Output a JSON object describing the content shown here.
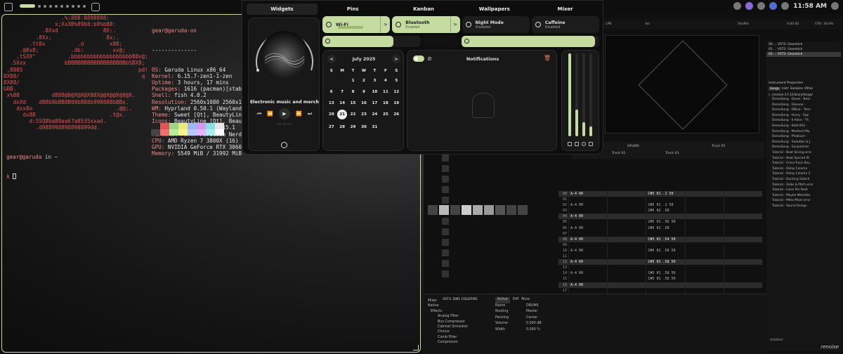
{
  "topbar": {
    "time": "11:58 AM"
  },
  "terminal": {
    "ascii": [
      "                  .%;888:8898898:",
      "                x;XxXB%89b8:b8%b88:",
      "            .8Xxd              8X:.",
      "          .8Xx;                 8x:.",
      "        .tt8x          .d        x88;",
      "     .@8x8;          .db:         xx@;",
      "    ,tSXX°          .bbbbbbbbbbbbbbbbbbbB8x@;",
      "  .SXxx            bBBBBBBBBBBBBBBBBBBbSBX8;",
      " ,888S                                    pd!",
      "8X88/                                      q",
      "8X88/",
      "GBB.",
      " x%88          d888@8@X@X@X88X@@X@@X@8@X.",
      "   dxXd    dB8b8bBB8B08bB88b998888bBBx.",
      "    dxx8o                          .@@;.",
      "      dx88                       .t@x.",
      "        d:SSQ8ba89aa67a8535xxad.",
      "          .d988998898898899dd."
    ],
    "info_header": "gear@garuda-os",
    "info_sep": "--------------",
    "info": [
      {
        "k": "OS",
        "v": "Garuda Linux x86_64"
      },
      {
        "k": "Kernel",
        "v": "6.15.7-zen1-1-zen"
      },
      {
        "k": "Uptime",
        "v": "3 hours, 17 mins"
      },
      {
        "k": "Packages",
        "v": "1616 (pacman)[stable]"
      },
      {
        "k": "Shell",
        "v": "fish 4.0.2"
      },
      {
        "k": "Resolution",
        "v": "2560x1080 2560x1080"
      },
      {
        "k": "WM",
        "v": "Hyprland 0.50.1 (Wayland)"
      },
      {
        "k": "Theme",
        "v": "Sweet [Qt], BeautyLine ["
      },
      {
        "k": "Icons",
        "v": "BeautyLine [Qt], BeautyL"
      },
      {
        "k": "Terminal",
        "v": "alacritty 0.15.1"
      },
      {
        "k": "Terminal Font",
        "v": "FiraCode Nerd Fo"
      },
      {
        "k": "CPU",
        "v": "AMD Ryzen 7 3800X (16) @ 4"
      },
      {
        "k": "GPU",
        "v": "NVIDIA GeForce RTX 3060 Li"
      },
      {
        "k": "Memory",
        "v": "5549 MiB / 31992 MiB"
      }
    ],
    "palette_top": [
      "#222222",
      "#e25555",
      "#9bd68a",
      "#eaea7a",
      "#9db8f0",
      "#d49af0",
      "#8ae0e0",
      "#e6e6e6"
    ],
    "palette_bottom": [
      "#444444",
      "#f07070",
      "#b6ec9c",
      "#f5f590",
      "#b4c8ff",
      "#e2b4ff",
      "#a8f0f0",
      "#ffffff"
    ],
    "prompt_user": "gear@garuda",
    "prompt_in": "in ~",
    "prompt_arrow": "λ"
  },
  "panel": {
    "tabs": [
      "Widgets",
      "Pins",
      "Kanban",
      "Wallpapers",
      "Mixer"
    ],
    "active_tab": 0,
    "player": {
      "title": "Electronic music and merch ...",
      "time": "--:-- / --:--",
      "prev": "⏮",
      "rewind": "⏪",
      "play": "▶",
      "forward": "⏩",
      "next": "⏭"
    },
    "toggles": [
      {
        "label": "Wi-Fi",
        "sub": "",
        "on": true,
        "chevron": ">"
      },
      {
        "label": "Bluetooth",
        "sub": "Enabled",
        "on": true,
        "chevron": ">"
      },
      {
        "label": "Night Mode",
        "sub": "Disabled",
        "on": false,
        "chevron": ""
      },
      {
        "label": "Caffeine",
        "sub": "Disabled",
        "on": false,
        "chevron": ""
      }
    ],
    "volume_level": 0.72,
    "mic_level": 0.97,
    "calendar": {
      "month": "July 2025",
      "prev": "<",
      "next": ">",
      "dow": [
        "S",
        "M",
        "T",
        "W",
        "T",
        "F",
        "S"
      ],
      "days": [
        "",
        "",
        "1",
        "2",
        "3",
        "4",
        "5",
        "6",
        "7",
        "8",
        "9",
        "10",
        "11",
        "12",
        "13",
        "14",
        "15",
        "16",
        "17",
        "18",
        "19",
        "20",
        "21",
        "22",
        "23",
        "24",
        "25",
        "26",
        "27",
        "28",
        "29",
        "30",
        "31",
        "",
        ""
      ],
      "today": "21"
    },
    "notifications": {
      "title": "Notifications"
    },
    "mixer_levels": [
      1.0,
      0.32,
      0.17,
      0.12
    ],
    "colors": {
      "accent": "#c5dca0",
      "trash": "#e07a50"
    }
  },
  "renoise": {
    "top_labels": [
      "LPB",
      "Vol",
      "Shuffle",
      "0.00.00",
      "CPU: 16.6%"
    ],
    "instruments": [
      "00 ... VST3: Geonkick",
      "01 ... VST3: Geonkick",
      "02 ... VST3: Geonkick"
    ],
    "instrument_properties": "Instrument Properties",
    "browser_tabs": [
      "Songs",
      "Instr",
      "Samples",
      "Other"
    ],
    "browser_path": "/.../renoise-3.5.1/Library/Songs/",
    "songs": [
      "DemoSong - Daeei - Bear",
      "DemoSong - Danooe -",
      "DemoSong - DBlue - Tenn",
      "DemoSong - Hurry - Sop",
      "DemoSong - Il-Alien - Th",
      "DemoSong - Keith303 -",
      "DemoSong - Medievil Mu",
      "DemoSong - Phobium -",
      "DemoSong - Sodutlan & J",
      "DemoSong - Sunjammer",
      "Tutorial - Beat Slicing.xrns",
      "Tutorial - Beat Synced W",
      "Tutorial - Cross-Track Rou",
      "Tutorial - Delay Column",
      "Tutorial - Delay Column 2",
      "Tutorial - Ducking Sidech",
      "Tutorial - Glide & Pitch.xrns",
      "Tutorial - Lines Per Beat",
      "Tutorial - Maybe Melodies",
      "Tutorial - Meta Mixer.xrns",
      "Tutorial - Sound Design"
    ],
    "track_drums": "DRUMS",
    "tracks": [
      "Track 02",
      "Track 03",
      "Track 05"
    ],
    "pattern": [
      {
        "n": "00",
        "a": "A-4 00",
        "b": "C#5 01 .1 50",
        "hl": true
      },
      {
        "n": "01",
        "a": "",
        "b": ""
      },
      {
        "n": "02",
        "a": "A-4 00",
        "b": "C#5 01 .1 50"
      },
      {
        "n": "03",
        "a": "",
        "b": "C#5 02 .58"
      },
      {
        "n": "04",
        "a": "A-4 00",
        "b": "",
        "hl": true
      },
      {
        "n": "05",
        "a": "",
        "b": "C#5 01 .56 50"
      },
      {
        "n": "06",
        "a": "A-4 00",
        "b": "C#5 01 .58"
      },
      {
        "n": "07",
        "a": "",
        "b": ""
      },
      {
        "n": "08",
        "a": "A-4 00",
        "b": "C#5 01 .54 50",
        "hl": true
      },
      {
        "n": "09",
        "a": "",
        "b": ""
      },
      {
        "n": "10",
        "a": "A-4 00",
        "b": "C#5 01 .58 50"
      },
      {
        "n": "11",
        "a": "",
        "b": ""
      },
      {
        "n": "12",
        "a": "A-4 00",
        "b": "C#5 01 .58 50",
        "hl": true
      },
      {
        "n": "13",
        "a": "",
        "b": ""
      },
      {
        "n": "14",
        "a": "A-4 00",
        "b": "C#5 01 .58 50"
      },
      {
        "n": "15",
        "a": "",
        "b": "C#5 01 .58 50"
      },
      {
        "n": "16",
        "a": "A-4 00",
        "b": "",
        "hl": true
      },
      {
        "n": "17",
        "a": "",
        "b": ""
      }
    ],
    "fx_tabs": [
      "Mixer",
      "Active",
      "Diff",
      "Mute"
    ],
    "fx_list": [
      "Native",
      "Effects",
      "Analog Filter",
      "Bus Compressor",
      "Cabinet Simulator",
      "Chorus",
      "Comb Filter",
      "Compressor"
    ],
    "props": [
      {
        "k": "Name",
        "v": "DRUMS"
      },
      {
        "k": "Routing",
        "v": "Master"
      },
      {
        "k": "Panning",
        "v": "Center"
      },
      {
        "k": "Volume",
        "v": "0.000 dB"
      },
      {
        "k": "Width",
        "v": "0.000 %"
      }
    ],
    "vst_label": "VST3: DM1 COLDFIRE",
    "untitled": "Untitled",
    "logo": "renoise"
  }
}
